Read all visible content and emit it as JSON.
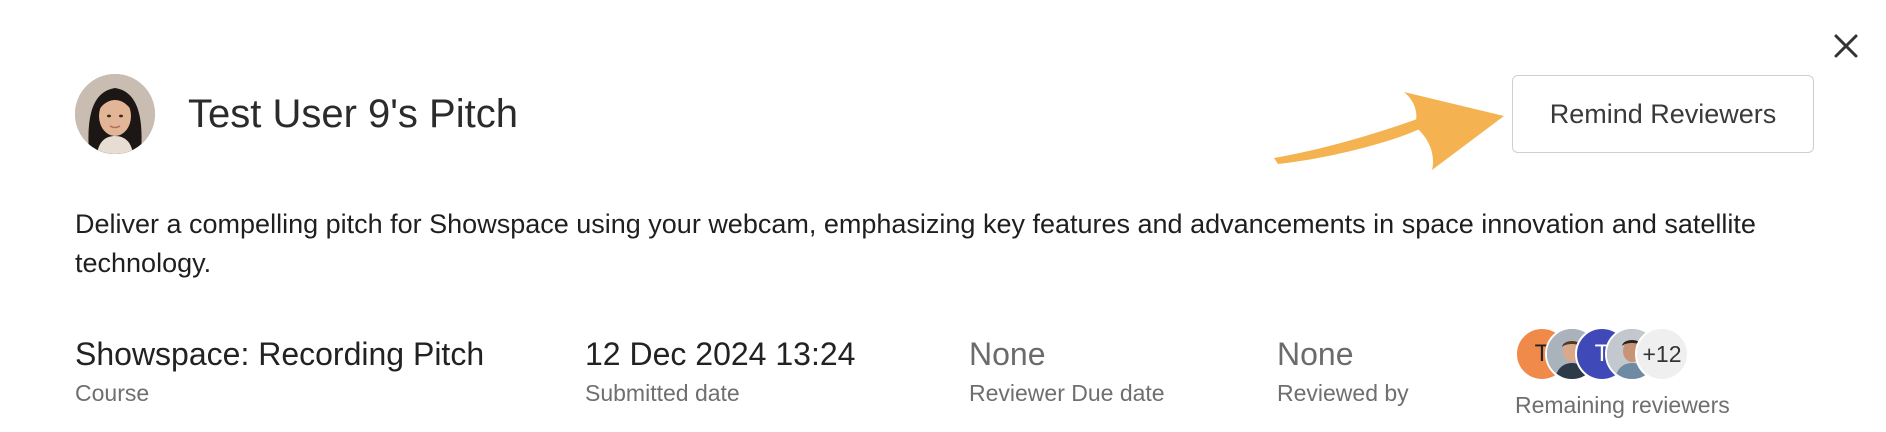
{
  "header": {
    "title": "Test User 9's Pitch",
    "remind_label": "Remind Reviewers"
  },
  "description": "Deliver a compelling pitch for Showspace using your webcam, emphasizing key features and advancements in space innovation and satellite technology.",
  "meta": {
    "course": {
      "value": "Showspace: Recording Pitch",
      "label": "Course"
    },
    "submitted": {
      "value": "12 Dec 2024 13:24",
      "label": "Submitted date"
    },
    "due": {
      "value": "None",
      "label": "Reviewer Due date"
    },
    "reviewed_by": {
      "value": "None",
      "label": "Reviewed by"
    },
    "remaining": {
      "label": "Remaining reviewers",
      "avatars": [
        {
          "initial": "T",
          "color": "#f08a4b"
        },
        {
          "initial": "",
          "color": "#8a94a0"
        },
        {
          "initial": "T",
          "color": "#3f4ab8"
        },
        {
          "initial": "",
          "color": "#9aa3ad"
        }
      ],
      "more": "+12"
    }
  },
  "colors": {
    "annotation_arrow": "#f4b350",
    "button_border": "#cfcfcf",
    "muted_text": "#6f6f6f"
  },
  "icons": {
    "close": "close-icon",
    "arrow": "arrow-annotation"
  }
}
